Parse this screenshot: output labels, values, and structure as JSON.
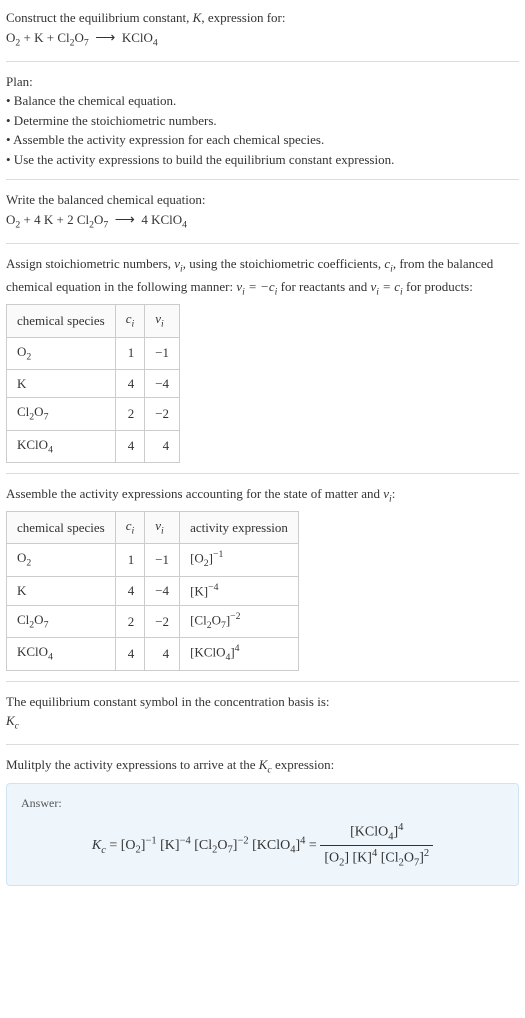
{
  "intro": {
    "line1": "Construct the equilibrium constant, ",
    "k": "K",
    "line1b": ", expression for:"
  },
  "eq_unbalanced": {
    "display": "O₂ + K + Cl₂O₇  ⟶  KClO₄"
  },
  "plan": {
    "title": "Plan:",
    "b1": "• Balance the chemical equation.",
    "b2": "• Determine the stoichiometric numbers.",
    "b3": "• Assemble the activity expression for each chemical species.",
    "b4": "• Use the activity expressions to build the equilibrium constant expression."
  },
  "balanced": {
    "title": "Write the balanced chemical equation:",
    "display": "O₂ + 4 K + 2 Cl₂O₇  ⟶  4 KClO₄"
  },
  "assign": {
    "text1a": "Assign stoichiometric numbers, ",
    "nu": "νᵢ",
    "text1b": ", using the stoichiometric coefficients, ",
    "ci": "cᵢ",
    "text1c": ", from the balanced chemical equation in the following manner: ",
    "rel1": "νᵢ = −cᵢ",
    "text1d": " for reactants and ",
    "rel2": "νᵢ = cᵢ",
    "text1e": " for products:"
  },
  "table1": {
    "h1": "chemical species",
    "h2": "cᵢ",
    "h3": "νᵢ",
    "rows": [
      {
        "sp": "O₂",
        "c": "1",
        "v": "−1"
      },
      {
        "sp": "K",
        "c": "4",
        "v": "−4"
      },
      {
        "sp": "Cl₂O₇",
        "c": "2",
        "v": "−2"
      },
      {
        "sp": "KClO₄",
        "c": "4",
        "v": "4"
      }
    ]
  },
  "assemble": {
    "text": "Assemble the activity expressions accounting for the state of matter and ",
    "nu": "νᵢ",
    "colon": ":"
  },
  "table2": {
    "h1": "chemical species",
    "h2": "cᵢ",
    "h3": "νᵢ",
    "h4": "activity expression",
    "rows": [
      {
        "sp": "O₂",
        "c": "1",
        "v": "−1",
        "a": "[O₂]⁻¹"
      },
      {
        "sp": "K",
        "c": "4",
        "v": "−4",
        "a": "[K]⁻⁴"
      },
      {
        "sp": "Cl₂O₇",
        "c": "2",
        "v": "−2",
        "a": "[Cl₂O₇]⁻²"
      },
      {
        "sp": "KClO₄",
        "c": "4",
        "v": "4",
        "a": "[KClO₄]⁴"
      }
    ]
  },
  "basis": {
    "text": "The equilibrium constant symbol in the concentration basis is:",
    "kc": "K𝑐"
  },
  "multiply": {
    "text1": "Mulitply the activity expressions to arrive at the ",
    "kc": "K𝑐",
    "text2": " expression:"
  },
  "answer": {
    "label": "Answer:",
    "lhs": "K𝑐 = [O₂]⁻¹ [K]⁻⁴ [Cl₂O₇]⁻² [KClO₄]⁴ = ",
    "num": "[KClO₄]⁴",
    "den": "[O₂] [K]⁴ [Cl₂O₇]²"
  },
  "chart_data": {
    "type": "table",
    "tables": [
      {
        "title": "stoichiometric numbers",
        "columns": [
          "chemical species",
          "cᵢ",
          "νᵢ"
        ],
        "rows": [
          [
            "O₂",
            1,
            -1
          ],
          [
            "K",
            4,
            -4
          ],
          [
            "Cl₂O₇",
            2,
            -2
          ],
          [
            "KClO₄",
            4,
            4
          ]
        ]
      },
      {
        "title": "activity expressions",
        "columns": [
          "chemical species",
          "cᵢ",
          "νᵢ",
          "activity expression"
        ],
        "rows": [
          [
            "O₂",
            1,
            -1,
            "[O₂]^−1"
          ],
          [
            "K",
            4,
            -4,
            "[K]^−4"
          ],
          [
            "Cl₂O₇",
            2,
            -2,
            "[Cl₂O₇]^−2"
          ],
          [
            "KClO₄",
            4,
            4,
            "[KClO₄]^4"
          ]
        ]
      }
    ]
  }
}
